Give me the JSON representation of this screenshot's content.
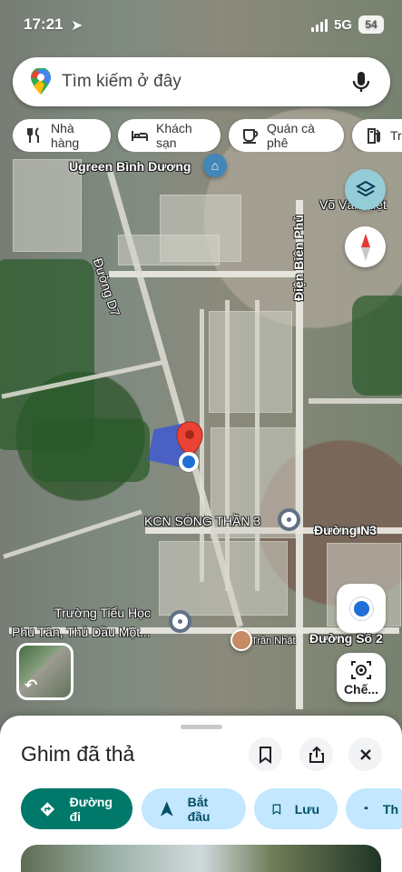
{
  "status": {
    "time": "17:21",
    "network": "5G",
    "battery": "54"
  },
  "search": {
    "placeholder": "Tìm kiếm ở đây"
  },
  "chips": [
    {
      "label": "Nhà hàng",
      "icon": "fork-knife-icon"
    },
    {
      "label": "Khách sạn",
      "icon": "bed-icon"
    },
    {
      "label": "Quán cà phê",
      "icon": "coffee-icon"
    },
    {
      "label": "Trạ",
      "icon": "fuel-icon"
    }
  ],
  "map": {
    "labels": {
      "ugreen": "Ugreen Bình Dương",
      "vo_van": "Võ Văn Kiệt",
      "dien_bien_phu": "Điện Biên Phủ",
      "duong_d7": "Đường D7",
      "kcn": "KCN SÓNG THẦN 3",
      "duong_n3": "Đường N3",
      "school_line1": "Trường Tiểu Học",
      "school_line2": "Phú Tân, Thủ Dầu Một...",
      "duong_so2": "Đường Số 2",
      "tran_nhat": "Trần Nhật"
    }
  },
  "controls": {
    "mode_label": "Chế..."
  },
  "sheet": {
    "title": "Ghim đã thả",
    "actions": [
      {
        "label": "Đường đi",
        "icon": "directions-icon"
      },
      {
        "label": "Bắt đầu",
        "icon": "navigation-arrow-icon"
      },
      {
        "label": "Lưu",
        "icon": "bookmark-icon"
      },
      {
        "label": "Th",
        "icon": "flag-icon"
      }
    ]
  }
}
